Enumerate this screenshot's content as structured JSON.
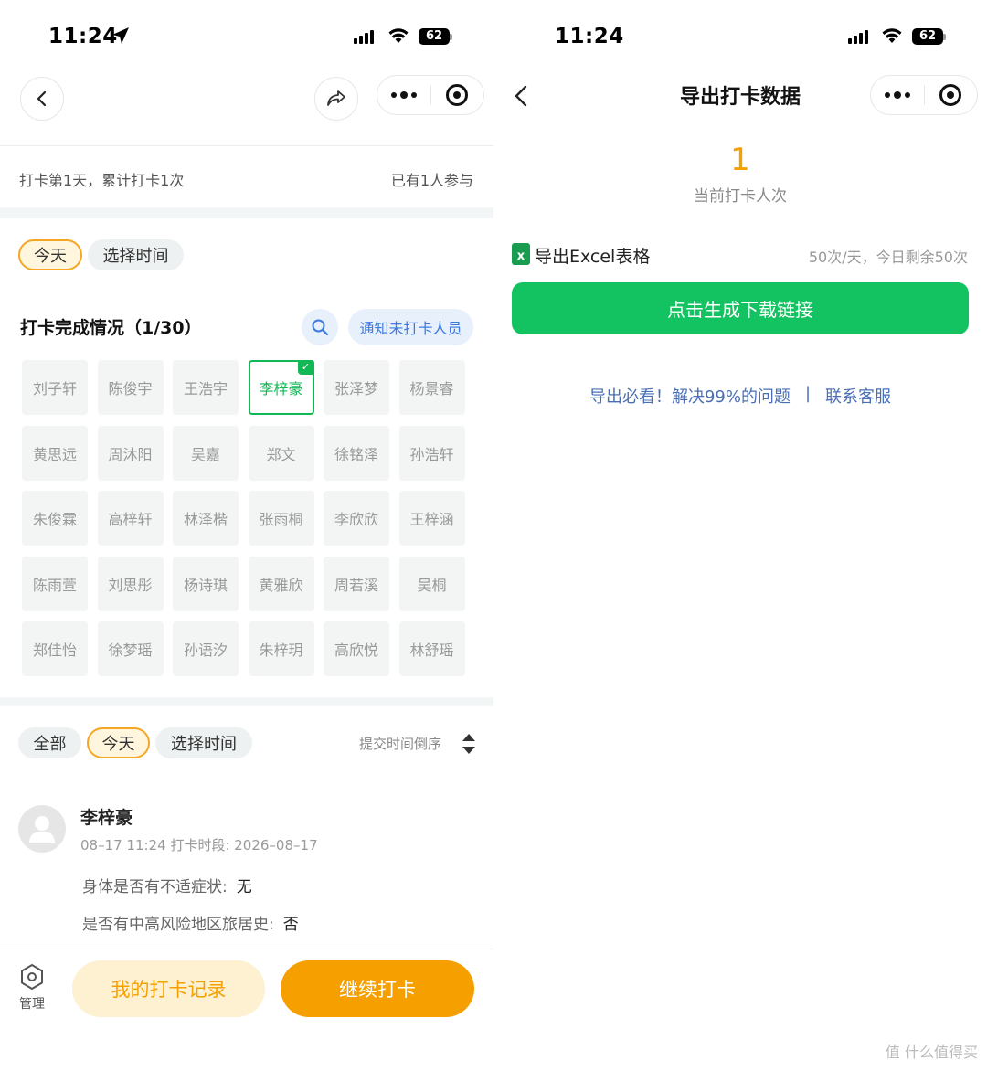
{
  "left": {
    "status": {
      "time": "11:24",
      "battery": "62"
    },
    "stats": {
      "summary": "打卡第1天，累计打卡1次",
      "participants": "已有1人参与"
    },
    "filter_top": [
      "今天",
      "选择时间"
    ],
    "completion": {
      "title": "打卡完成情况（1/30）",
      "notify_label": "通知未打卡人员"
    },
    "names": [
      "刘子轩",
      "陈俊宇",
      "王浩宇",
      "李梓豪",
      "张泽梦",
      "杨景睿",
      "黄思远",
      "周沐阳",
      "吴嘉",
      "郑文",
      "徐铭泽",
      "孙浩轩",
      "朱俊霖",
      "高梓轩",
      "林泽楷",
      "张雨桐",
      "李欣欣",
      "王梓涵",
      "陈雨萱",
      "刘思彤",
      "杨诗琪",
      "黄雅欣",
      "周若溪",
      "吴桐",
      "郑佳怡",
      "徐梦瑶",
      "孙语汐",
      "朱梓玥",
      "高欣悦",
      "林舒瑶"
    ],
    "done_name_index": 3,
    "filter_bottom": [
      "全部",
      "今天",
      "选择时间"
    ],
    "sort_label": "提交时间倒序",
    "record": {
      "name": "李梓豪",
      "meta": "08–17 11:24 打卡时段: 2026–08–17",
      "q1_label": "身体是否有不适症状:",
      "q1_value": "无",
      "q2_label": "是否有中高风险地区旅居史:",
      "q2_value": "否"
    },
    "bottom_bar": {
      "manage_label": "管理",
      "my_records": "我的打卡记录",
      "continue": "继续打卡"
    }
  },
  "right": {
    "status": {
      "time": "11:24",
      "battery": "62"
    },
    "title": "导出打卡数据",
    "count": "1",
    "count_label": "当前打卡人次",
    "export_label": "导出Excel表格",
    "excel_icon_letter": "x",
    "quota": "50次/天，今日剩余50次",
    "generate_button": "点击生成下载链接",
    "help_link": "导出必看！解决99%的问题",
    "divider": "|",
    "contact_link": "联系客服"
  },
  "watermark": "值 什么值得买",
  "colors": {
    "orange": "#f5a000",
    "green": "#13c260",
    "link": "#4a6fb5",
    "check_green": "#12b856"
  }
}
